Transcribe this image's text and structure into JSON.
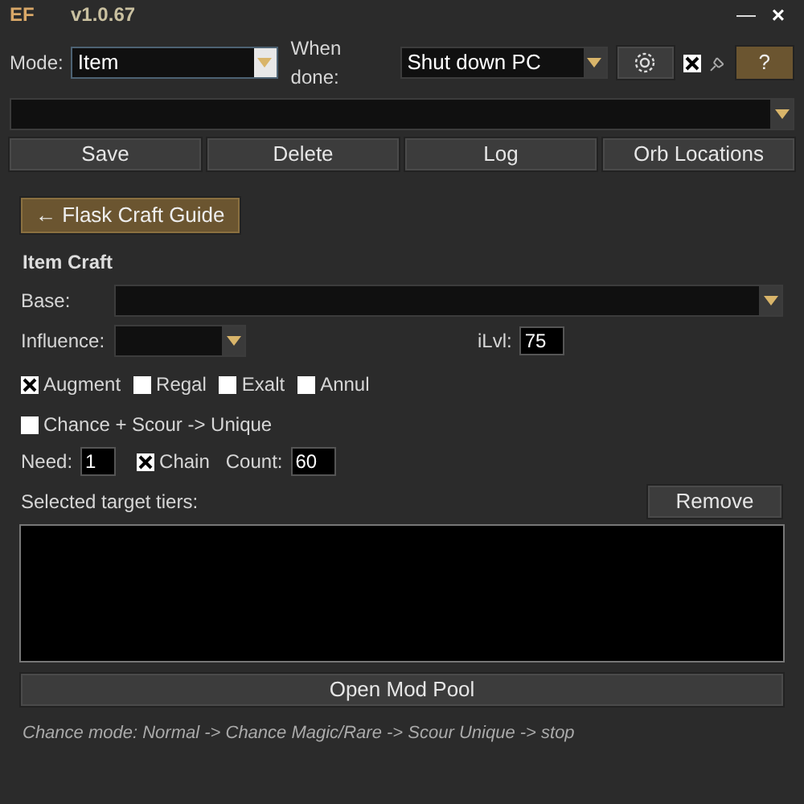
{
  "window": {
    "title": "EF",
    "version": "v1.0.67",
    "minimize": "—",
    "close": "×"
  },
  "toolbar": {
    "mode_label": "Mode:",
    "mode_value": "Item",
    "when_done_label": "When done:",
    "when_done_value": "Shut down PC",
    "pin_checked": true,
    "help": "?"
  },
  "actions": [
    "Save",
    "Delete",
    "Log",
    "Orb Locations"
  ],
  "guide_button": "← Flask Craft Guide",
  "section_title": "Item Craft",
  "base_label": "Base:",
  "influence_label": "Influence:",
  "ilvl_label": "iLvl:",
  "ilvl_value": "75",
  "orbs": [
    {
      "label": "Augment",
      "checked": true
    },
    {
      "label": "Regal",
      "checked": false
    },
    {
      "label": "Exalt",
      "checked": false
    },
    {
      "label": "Annul",
      "checked": false
    }
  ],
  "chance": {
    "label": "Chance + Scour -> Unique",
    "checked": false
  },
  "need_label": "Need:",
  "need_value": "1",
  "chain": {
    "label": "Chain",
    "checked": true
  },
  "count_label": "Count:",
  "count_value": "60",
  "tiers_label": "Selected target tiers:",
  "remove_button": "Remove",
  "mod_pool_button": "Open Mod Pool",
  "footer": "Chance mode: Normal -> Chance Magic/Rare -> Scour Unique -> stop"
}
